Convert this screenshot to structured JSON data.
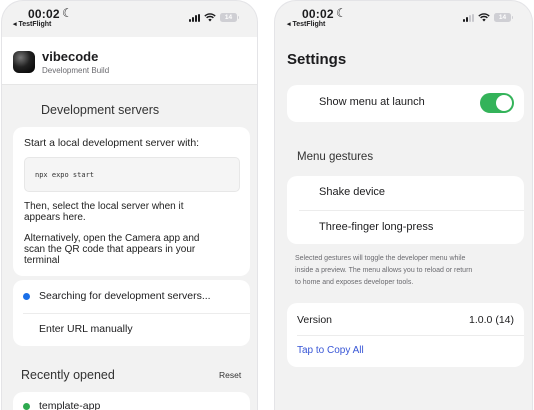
{
  "status_bar": {
    "time": "00:02",
    "back_label": "◂ TestFlight",
    "battery": "14"
  },
  "left": {
    "app": {
      "name": "vibecode",
      "subtitle": "Development Build"
    },
    "dev_servers": {
      "title": "Development servers",
      "intro": "Start a local development server with:",
      "command": "npx expo start",
      "then_line1": "Then, select the local server when it",
      "then_line2": "appears here.",
      "alt_line1": "Alternatively, open the Camera app and",
      "alt_line2": "scan the QR code that appears in your",
      "alt_line3": "terminal",
      "searching": "Searching for development servers...",
      "enter_url": "Enter URL manually"
    },
    "recent": {
      "title": "Recently opened",
      "reset": "Reset",
      "items": [
        {
          "label": "template-app"
        }
      ]
    }
  },
  "right": {
    "title": "Settings",
    "show_menu": {
      "label": "Show menu at launch",
      "enabled": true
    },
    "gestures": {
      "title": "Menu gestures",
      "items": [
        "Shake device",
        "Three-finger long-press"
      ],
      "note_line1": "Selected gestures will toggle the developer menu while",
      "note_line2": "inside a preview. The menu allows you to reload or return",
      "note_line3": "to home and exposes developer tools."
    },
    "version": {
      "label": "Version",
      "value": "1.0.0 (14)",
      "copy": "Tap to Copy All"
    }
  },
  "colors": {
    "accent_blue": "#1a6fe8",
    "toggle_green": "#34b35a",
    "link": "#3856d6",
    "dot_green": "#2eaa4f"
  }
}
